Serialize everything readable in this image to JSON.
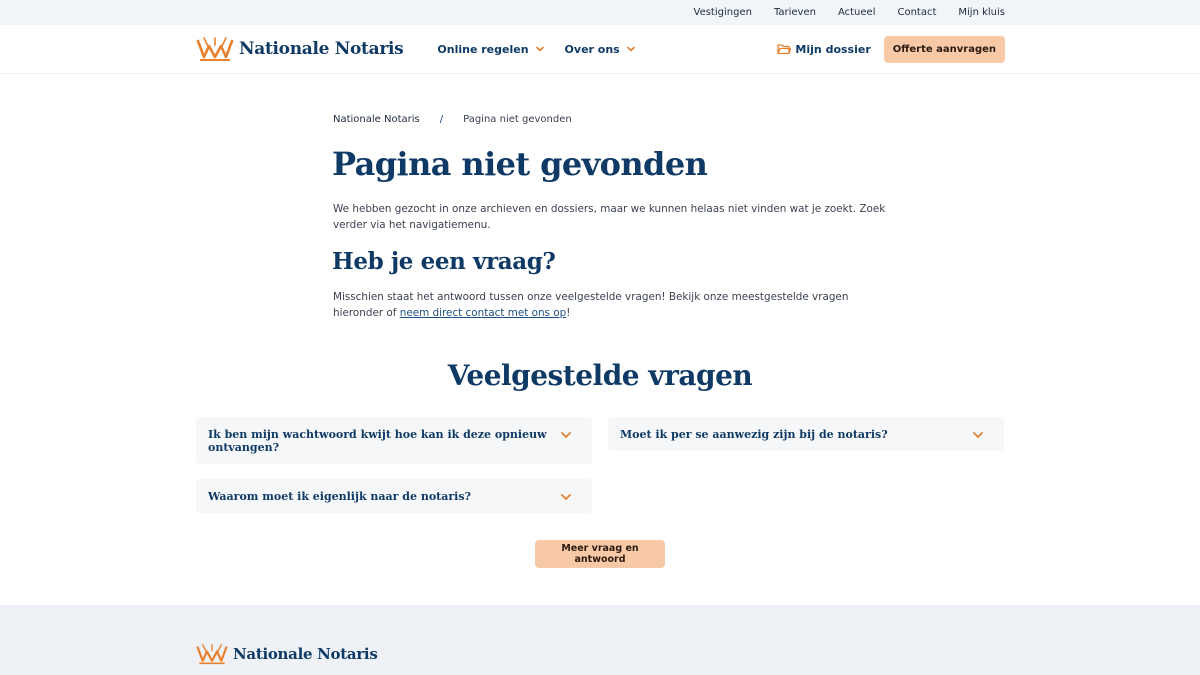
{
  "topbar": {
    "links": [
      "Vestigingen",
      "Tarieven",
      "Actueel",
      "Contact",
      "Mijn kluis"
    ]
  },
  "header": {
    "brand": "Nationale Notaris",
    "nav": [
      {
        "label": "Online regelen",
        "icon": "chevron-down-icon"
      },
      {
        "label": "Over ons",
        "icon": "chevron-down-icon"
      }
    ],
    "dossier_label": "Mijn dossier",
    "offerte_label": "Offerte aanvragen"
  },
  "breadcrumb": {
    "home": "Nationale Notaris",
    "separator": "/",
    "current": "Pagina niet gevonden"
  },
  "main": {
    "title": "Pagina niet gevonden",
    "intro": "We hebben gezocht in onze archieven en dossiers, maar we kunnen helaas niet vinden wat je zoekt. Zoek verder via het navigatiemenu.",
    "question_title": "Heb je een vraag?",
    "question_text_before": "Misschien staat het antwoord tussen onze veelgestelde vragen! Bekijk onze meestgestelde vragen hieronder of ",
    "question_link": "neem direct contact met ons op",
    "question_text_after": "!"
  },
  "faq": {
    "title": "Veelgestelde vragen",
    "items": [
      "Ik ben mijn wachtwoord kwijt hoe kan ik deze opnieuw ontvangen?",
      "Moet ik per se aanwezig zijn bij de notaris?",
      "Waarom moet ik eigenlijk naar de notaris?"
    ],
    "more_label": "Meer vraag en antwoord"
  },
  "footer": {
    "brand": "Nationale Notaris"
  },
  "colors": {
    "navy": "#103a66",
    "accent": "#e8812f",
    "button": "#f8c9a6"
  }
}
